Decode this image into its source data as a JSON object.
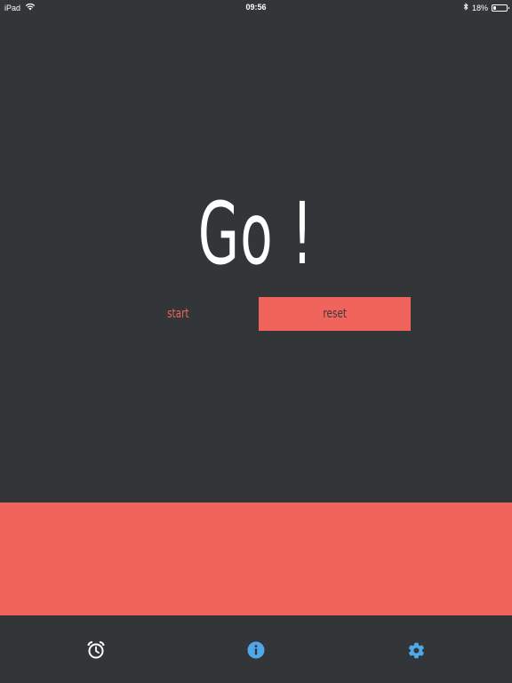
{
  "status_bar": {
    "device": "iPad",
    "time": "09:56",
    "battery": "18%",
    "battery_level": 0.18,
    "icons": [
      "wifi-icon",
      "bluetooth-icon",
      "battery-icon"
    ]
  },
  "main": {
    "headline": "Go !",
    "start_label": "start",
    "reset_label": "reset"
  },
  "tab_bar": {
    "tabs": [
      {
        "icon": "alarm-clock-icon",
        "color": "#ffffff"
      },
      {
        "icon": "info-icon",
        "color": "#4fa8e8"
      },
      {
        "icon": "gear-icon",
        "color": "#4fa8e8"
      }
    ]
  },
  "colors": {
    "background": "#333638",
    "accent": "#f0645b",
    "text": "#ffffff",
    "active_icon": "#4fa8e8"
  }
}
